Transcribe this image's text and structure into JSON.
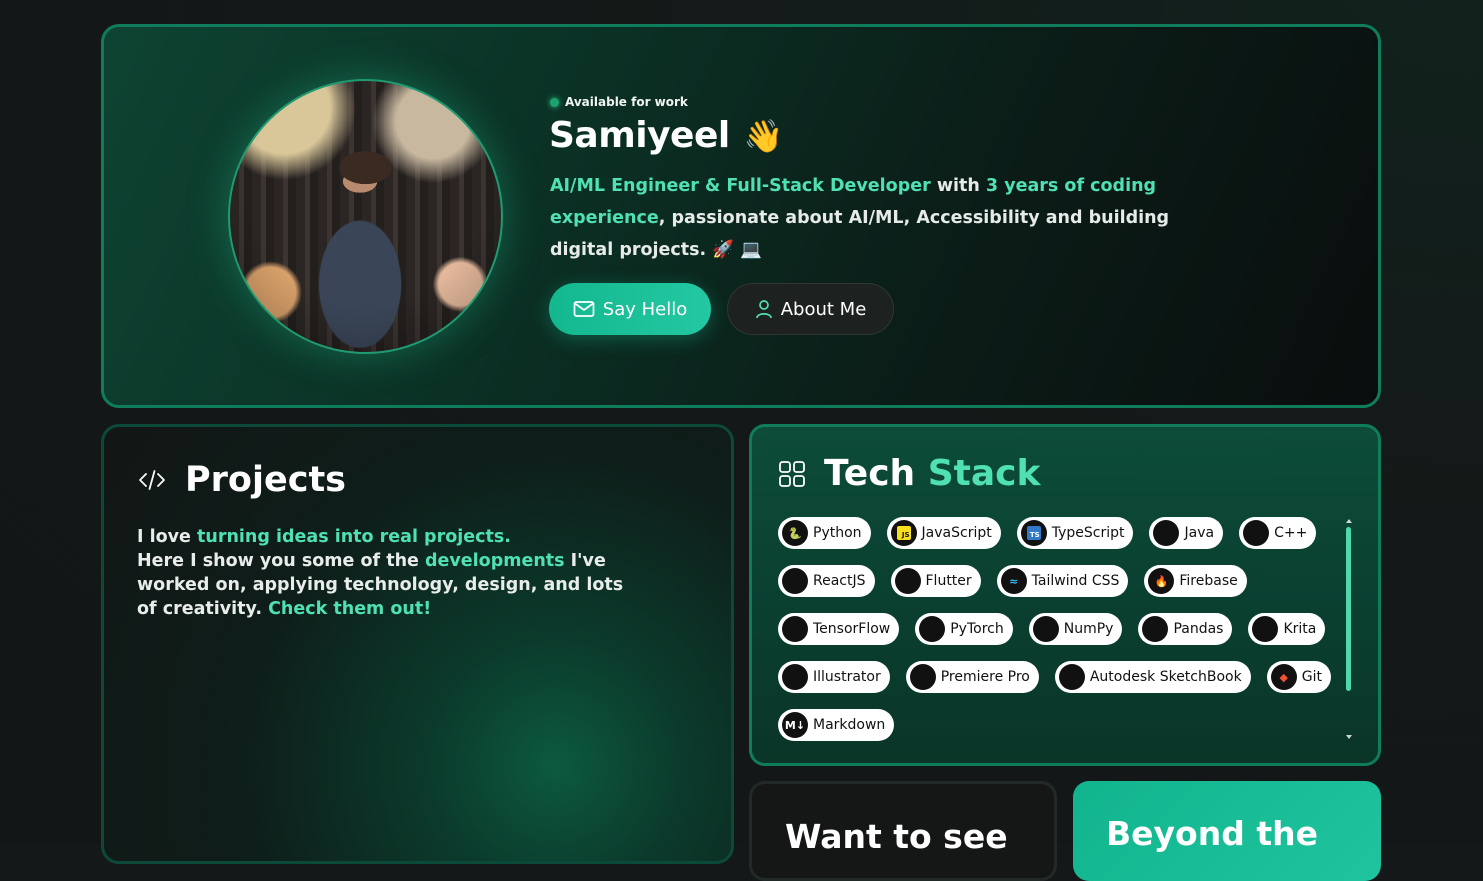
{
  "hero": {
    "status": "Available for work",
    "name": "Samiyeel",
    "wave": "👋",
    "bio_role": "AI/ML Engineer & Full-Stack Developer",
    "bio_with": " with ",
    "bio_years": "3 years of coding experience",
    "bio_rest": ", passionate about AI/ML, Accessibility and building digital projects. 🚀 💻",
    "say_hello": "Say Hello",
    "about_me": "About Me"
  },
  "projects": {
    "title": "Projects",
    "p1": "I love ",
    "p1_hl": "turning ideas into real projects.",
    "p2": "Here I show you some of the ",
    "p2_hl": "developments",
    "p3": " I've worked on, applying technology, design, and lots of creativity. ",
    "p3_hl": "Check them out!"
  },
  "tech": {
    "title_1": "Tech",
    "title_2": "Stack",
    "chips": [
      {
        "label": "Python",
        "icon": "python-icon"
      },
      {
        "label": "JavaScript",
        "icon": "javascript-icon"
      },
      {
        "label": "TypeScript",
        "icon": "typescript-icon"
      },
      {
        "label": "Java",
        "icon": "java-icon"
      },
      {
        "label": "C++",
        "icon": "cpp-icon"
      },
      {
        "label": "ReactJS",
        "icon": "react-icon"
      },
      {
        "label": "Flutter",
        "icon": "flutter-icon"
      },
      {
        "label": "Tailwind CSS",
        "icon": "tailwind-icon"
      },
      {
        "label": "Firebase",
        "icon": "firebase-icon"
      },
      {
        "label": "TensorFlow",
        "icon": "tensorflow-icon"
      },
      {
        "label": "PyTorch",
        "icon": "pytorch-icon"
      },
      {
        "label": "NumPy",
        "icon": "numpy-icon"
      },
      {
        "label": "Pandas",
        "icon": "pandas-icon"
      },
      {
        "label": "Krita",
        "icon": "krita-icon"
      },
      {
        "label": "Illustrator",
        "icon": "illustrator-icon"
      },
      {
        "label": "Premiere Pro",
        "icon": "premiere-icon"
      },
      {
        "label": "Autodesk SketchBook",
        "icon": "sketchbook-icon"
      },
      {
        "label": "Git",
        "icon": "git-icon"
      },
      {
        "label": "Markdown",
        "icon": "markdown-icon"
      }
    ]
  },
  "cards": {
    "want_to_see": "Want to see",
    "beyond_the": "Beyond the"
  },
  "colors": {
    "accent": "#4fe0b3",
    "primary_button": "#14b88f",
    "border": "#0f7c5c"
  }
}
